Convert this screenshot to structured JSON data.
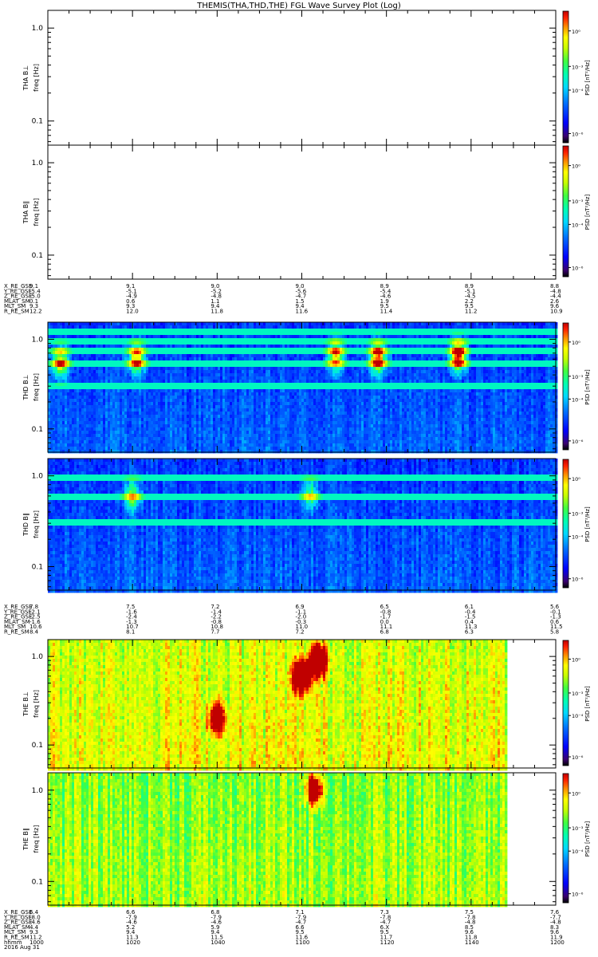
{
  "title": "THEMIS(THA,THD,THE) FGL Wave Survey Plot (Log)",
  "colors": {
    "axis": "#000000",
    "background": "#ffffff"
  },
  "chart_data": [
    {
      "type": "heatmap",
      "id": "tha_perp",
      "ylabel": "THA B⊥",
      "ylabel2": "freq [Hz]",
      "yscale": "log",
      "ylim": [
        0.055,
        1.55
      ],
      "yticks": [
        0.1,
        1.0
      ],
      "ytick_labels": [
        "0.1",
        "1.0"
      ],
      "colorbar": {
        "label": "PSD [nT²/Hz]",
        "scale": "log",
        "range": [
          1e-09,
          100.0
        ],
        "tick_labels": [
          "10⁰",
          "10⁻³",
          "10⁻⁴",
          "10⁻⁶"
        ]
      },
      "data_present": false
    },
    {
      "type": "heatmap",
      "id": "tha_par",
      "ylabel": "THA B∥",
      "ylabel2": "freq [Hz]",
      "yscale": "log",
      "ylim": [
        0.055,
        1.55
      ],
      "yticks": [
        0.1,
        1.0
      ],
      "ytick_labels": [
        "0.1",
        "1.0"
      ],
      "colorbar": {
        "label": "PSD [nT²/Hz]",
        "scale": "log",
        "range": [
          1e-09,
          100.0
        ],
        "tick_labels": [
          "10⁰",
          "10⁻³",
          "10⁻⁴",
          "10⁻⁶"
        ]
      },
      "data_present": false,
      "ephemeris": {
        "labels": [
          "X_RE_GSE",
          "Y_RE_GSE",
          "Z_RE_GSE",
          "MLAT_SM",
          "MLT_SM",
          "R_RE_SM"
        ],
        "columns": [
          [
            "9.1",
            "-5.4",
            "-5.0",
            "0.1",
            "9.3",
            "12.2"
          ],
          [
            "9.1",
            "-5.1",
            "-4.9",
            "0.6",
            "9.3",
            "12.0"
          ],
          [
            "9.0",
            "-5.2",
            "-4.8",
            "1.1",
            "9.4",
            "11.8"
          ],
          [
            "9.0",
            "-5.6",
            "-4.7",
            "1.5",
            "9.4",
            "11.6"
          ],
          [
            "8.9",
            "-5.4",
            "-4.6",
            "1.9",
            "9.5",
            "11.4"
          ],
          [
            "8.9",
            "-5.1",
            "-4.5",
            "2.2",
            "9.5",
            "11.2"
          ],
          [
            "8.8",
            "-4.8",
            "-4.4",
            "2.6",
            "9.6",
            "10.9"
          ]
        ]
      }
    },
    {
      "type": "heatmap",
      "id": "thd_perp",
      "ylabel": "THD B⊥",
      "ylabel2": "freq [Hz]",
      "yscale": "log",
      "ylim": [
        0.055,
        1.55
      ],
      "yticks": [
        0.1,
        1.0
      ],
      "ytick_labels": [
        "0.1",
        "1.0"
      ],
      "colorbar": {
        "label": "PSD [nT²/Hz]",
        "scale": "log",
        "range": [
          1e-09,
          100.0
        ],
        "tick_labels": [
          "10⁰",
          "10⁻³",
          "10⁻⁴",
          "10⁻⁶"
        ]
      },
      "data_present": true,
      "level": "low",
      "bright_bands_hz": [
        1.2,
        0.95,
        0.75,
        0.55,
        0.3
      ],
      "events": [
        {
          "time": "1003",
          "freq_hz": 0.55,
          "strength": 0.55
        },
        {
          "time": "1021",
          "freq_hz": 0.6,
          "strength": 0.6
        },
        {
          "time": "1068",
          "freq_hz": 0.65,
          "strength": 0.55
        },
        {
          "time": "1097",
          "freq_hz": 0.65,
          "strength": 0.75
        },
        {
          "time": "1118",
          "freq_hz": 0.62,
          "strength": 0.7
        }
      ]
    },
    {
      "type": "heatmap",
      "id": "thd_par",
      "ylabel": "THD B∥",
      "ylabel2": "freq [Hz]",
      "yscale": "log",
      "ylim": [
        0.055,
        1.55
      ],
      "yticks": [
        0.1,
        1.0
      ],
      "ytick_labels": [
        "0.1",
        "1.0"
      ],
      "colorbar": {
        "label": "PSD [nT²/Hz]",
        "scale": "log",
        "range": [
          1e-09,
          100.0
        ],
        "tick_labels": [
          "10⁰",
          "10⁻³",
          "10⁻⁴",
          "10⁻⁶"
        ]
      },
      "data_present": true,
      "level": "low",
      "bright_bands_hz": [
        0.95,
        0.6,
        0.3
      ],
      "events": [
        {
          "time": "1020",
          "freq_hz": 0.6,
          "strength": 0.4
        },
        {
          "time": "1102",
          "freq_hz": 0.62,
          "strength": 0.35
        }
      ],
      "ephemeris": {
        "labels": [
          "X_RE_GSE",
          "Y_RE_GSE",
          "Z_RE_GSE",
          "MLAT_SM",
          "MLT_SM",
          "R_RE_SM"
        ],
        "columns": [
          [
            "7.8",
            "-2.1",
            "-2.5",
            "-1.6",
            "10.6",
            "8.4"
          ],
          [
            "7.5",
            "-1.6",
            "-2.4",
            "-1.3",
            "10.7",
            "8.1"
          ],
          [
            "7.2",
            "-1.4",
            "-2.2",
            "-0.8",
            "10.8",
            "7.7"
          ],
          [
            "6.9",
            "-1.1",
            "-2.0",
            "-0.3",
            "11.0",
            "7.2"
          ],
          [
            "6.5",
            "-0.8",
            "-1.7",
            "0.0",
            "11.1",
            "6.8"
          ],
          [
            "6.1",
            "-0.4",
            "-1.5",
            "0.4",
            "11.3",
            "6.3"
          ],
          [
            "5.6",
            "-0.1",
            "-1.3",
            "0.6",
            "11.5",
            "5.8"
          ]
        ]
      }
    },
    {
      "type": "heatmap",
      "id": "the_perp",
      "ylabel": "THE B⊥",
      "ylabel2": "freq [Hz]",
      "yscale": "log",
      "ylim": [
        0.055,
        1.55
      ],
      "yticks": [
        0.1,
        1.0
      ],
      "ytick_labels": [
        "0.1",
        "1.0"
      ],
      "colorbar": {
        "label": "PSD [nT²/Hz]",
        "scale": "log",
        "range": [
          1e-09,
          100.0
        ],
        "tick_labels": [
          "10⁰",
          "10⁻³",
          "10⁻⁴",
          "10⁻⁶"
        ]
      },
      "data_present": true,
      "data_end_time": "1148",
      "level": "high",
      "bright_bands_hz": [],
      "events": [
        {
          "time": "1100",
          "freq_hz": 0.6,
          "strength": 0.8
        },
        {
          "time": "1104",
          "freq_hz": 0.9,
          "strength": 0.7
        },
        {
          "time": "1040",
          "freq_hz": 0.2,
          "strength": 0.5
        }
      ]
    },
    {
      "type": "heatmap",
      "id": "the_par",
      "ylabel": "THE B∥",
      "ylabel2": "freq [Hz]",
      "yscale": "log",
      "ylim": [
        0.055,
        1.55
      ],
      "yticks": [
        0.1,
        1.0
      ],
      "ytick_labels": [
        "0.1",
        "1.0"
      ],
      "colorbar": {
        "label": "PSD [nT²/Hz]",
        "scale": "log",
        "range": [
          1e-09,
          100.0
        ],
        "tick_labels": [
          "10⁰",
          "10⁻³",
          "10⁻⁴",
          "10⁻⁶"
        ]
      },
      "data_present": true,
      "data_end_time": "1148",
      "level": "mid",
      "bright_bands_hz": [],
      "events": [
        {
          "time": "1103",
          "freq_hz": 1.0,
          "strength": 0.6
        }
      ],
      "ephemeris": {
        "labels": [
          "X_RE_GSE",
          "Y_RE_GSE",
          "Z_RE_GSE",
          "MLAT_SM",
          "MLT_SM",
          "R_RE_SM",
          "hhmm",
          "2016 Aug 31"
        ],
        "columns": [
          [
            "6.4",
            "-8.0",
            "-4.6",
            "4.4",
            "9.3",
            "11.2",
            "1000"
          ],
          [
            "6.6",
            "-7.9",
            "-4.6",
            "5.2",
            "9.4",
            "11.3",
            "1020"
          ],
          [
            "6.8",
            "-7.9",
            "-4.6",
            "5.9",
            "9.4",
            "11.5",
            "1040"
          ],
          [
            "7.1",
            "-7.9",
            "-4.7",
            "6.6",
            "9.5",
            "11.6",
            "1100"
          ],
          [
            "7.3",
            "-7.8",
            "-4.7",
            "6.X",
            "9.5",
            "11.7",
            "1120"
          ],
          [
            "7.5",
            "-7.8",
            "-4.8",
            "8.5",
            "9.6",
            "11.8",
            "1140"
          ],
          [
            "7.6",
            "-7.7",
            "-4.8",
            "8.3",
            "9.6",
            "11.9",
            "1200"
          ]
        ]
      }
    }
  ]
}
